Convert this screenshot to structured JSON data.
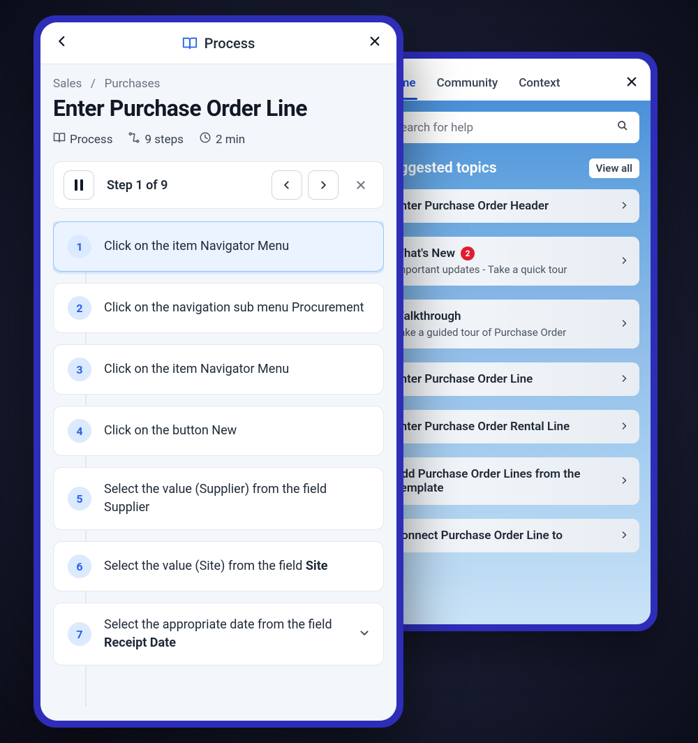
{
  "backPanel": {
    "tabs": [
      "Home",
      "Community",
      "Context"
    ],
    "activeTab": 0,
    "searchPlaceholder": "Search for help",
    "sectionTitle": "Suggested topics",
    "viewAll": "View all",
    "topics": [
      {
        "title": "Enter Purchase Order Header",
        "sub": ""
      },
      {
        "title": "What's New",
        "sub": "Important updates - Take a quick tour",
        "badge": "2"
      },
      {
        "title": "Walkthrough",
        "sub": "Take a guided tour of Purchase Order"
      },
      {
        "title": "Enter Purchase Order Line",
        "sub": ""
      },
      {
        "title": "Enter Purchase Order Rental Line",
        "sub": ""
      },
      {
        "title": "Add Purchase Order Lines from the Template",
        "sub": ""
      },
      {
        "title": "Connect Purchase Order Line to",
        "sub": ""
      }
    ]
  },
  "frontPanel": {
    "headerTitle": "Process",
    "breadcrumb": {
      "root": "Sales",
      "sep": "/",
      "current": "Purchases"
    },
    "pageTitle": "Enter Purchase Order Line",
    "meta": {
      "processLabel": "Process",
      "stepsLabel": "9 steps",
      "timeLabel": "2 min"
    },
    "controls": {
      "stepOf": "Step 1 of 9"
    },
    "steps": [
      {
        "n": "1",
        "html": "Click on the item Navigator Menu",
        "active": true
      },
      {
        "n": "2",
        "html": "Click on the navigation sub menu Procurement"
      },
      {
        "n": "3",
        "html": "Click on the item Navigator Menu"
      },
      {
        "n": "4",
        "html": "Click on the button New"
      },
      {
        "n": "5",
        "html": "Select the value (Supplier) from the field Supplier"
      },
      {
        "n": "6",
        "html": "Select the value (Site) from the field <b>Site</b>"
      },
      {
        "n": "7",
        "html": "Select the appropriate date from the field <b>Receipt Date</b>",
        "expandable": true
      }
    ]
  }
}
